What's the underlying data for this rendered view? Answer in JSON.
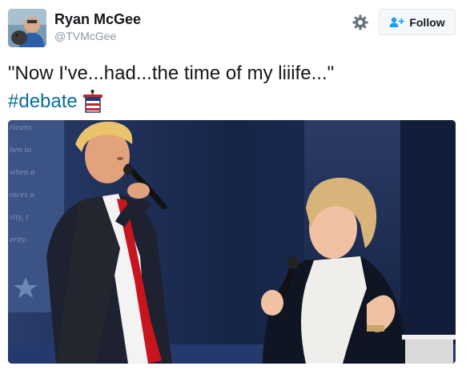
{
  "tweet": {
    "author_name": "Ryan McGee",
    "author_handle": "@TVMcGee",
    "follow_label": "Follow",
    "text_line1": "\"Now I've...had...the time of my liiife...\"",
    "hashtag": "#debate"
  },
  "icons": {
    "gear": "gear-icon",
    "follow": "follow-user-icon",
    "hashtag_emoji": "debate-podium-icon"
  },
  "colors": {
    "hashtag": "#0b6e99",
    "handle": "#8899a6",
    "button_bg": "#f5f8fa",
    "follow_icon": "#1da1f2"
  },
  "photo_background_text": [
    "ricans",
    "hen to",
    "when a",
    "oices a",
    "sity, t",
    "erity."
  ]
}
